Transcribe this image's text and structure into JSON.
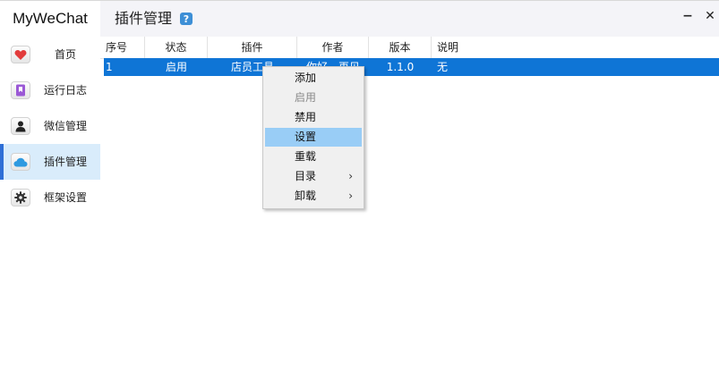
{
  "app": {
    "brand": "MyWeChat"
  },
  "sidebar": {
    "items": [
      {
        "label": "首页",
        "icon": "heart-icon",
        "active": false
      },
      {
        "label": "运行日志",
        "icon": "bookmark-icon",
        "active": false
      },
      {
        "label": "微信管理",
        "icon": "user-icon",
        "active": false
      },
      {
        "label": "插件管理",
        "icon": "cloud-icon",
        "active": true
      },
      {
        "label": "框架设置",
        "icon": "gear-icon",
        "active": false
      }
    ]
  },
  "header": {
    "title": "插件管理",
    "help_symbol": "?",
    "minimize_symbol": "−",
    "close_symbol": "✕"
  },
  "table": {
    "columns": [
      "序号",
      "状态",
      "插件",
      "作者",
      "版本",
      "说明"
    ],
    "rows": [
      {
        "index": "1",
        "status": "启用",
        "plugin": "店员工具",
        "author": "你好，再见",
        "version": "1.1.0",
        "description": "无"
      }
    ]
  },
  "context_menu": {
    "items": [
      {
        "label": "添加",
        "disabled": false,
        "submenu": false
      },
      {
        "label": "启用",
        "disabled": true,
        "submenu": false
      },
      {
        "label": "禁用",
        "disabled": false,
        "submenu": false
      },
      {
        "label": "设置",
        "disabled": false,
        "submenu": false,
        "highlighted": true
      },
      {
        "label": "重载",
        "disabled": false,
        "submenu": false
      },
      {
        "label": "目录",
        "disabled": false,
        "submenu": true
      },
      {
        "label": "卸载",
        "disabled": false,
        "submenu": true
      }
    ],
    "submenu_arrow": "›"
  },
  "colors": {
    "selected_row": "#0f75d6",
    "active_nav": "#d9ecfb",
    "active_bar": "#2f6fd6",
    "menu_highlight": "#99cdf6",
    "help_icon": "#3d8fd6"
  }
}
